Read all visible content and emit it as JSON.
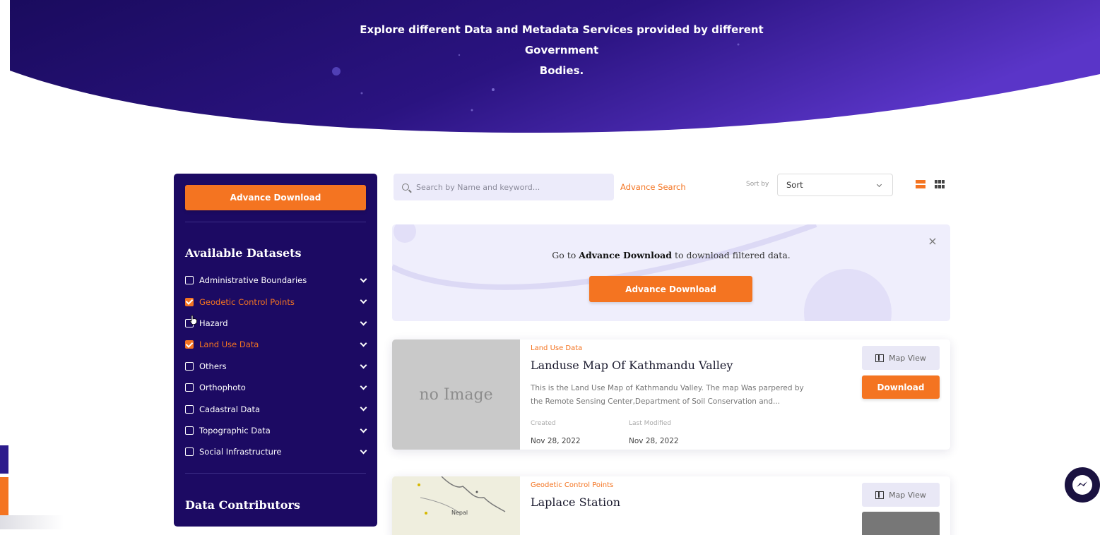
{
  "hero": {
    "line1": "Explore different Data and Metadata Services provided by different Government",
    "line2": "Bodies."
  },
  "sidebar": {
    "advance_download_label": "Advance Download",
    "datasets_heading": "Available Datasets",
    "datasets": [
      {
        "label": "Administrative Boundaries",
        "checked": false
      },
      {
        "label": "Geodetic Control Points",
        "checked": true
      },
      {
        "label": "Hazard",
        "checked": false
      },
      {
        "label": "Land Use Data",
        "checked": true
      },
      {
        "label": "Others",
        "checked": false
      },
      {
        "label": "Orthophoto",
        "checked": false
      },
      {
        "label": "Cadastral Data",
        "checked": false
      },
      {
        "label": "Topographic Data",
        "checked": false
      },
      {
        "label": "Social Infrastructure",
        "checked": false
      }
    ],
    "contributors_heading": "Data Contributors"
  },
  "toolbar": {
    "search_placeholder": "Search by Name and keyword...",
    "advance_search_label": "Advance Search",
    "sort_by_label": "Sort by",
    "sort_value": "Sort"
  },
  "banner": {
    "text_before": "Go to ",
    "text_bold": "Advance Download",
    "text_after": " to download filtered data.",
    "button_label": "Advance Download"
  },
  "results": [
    {
      "category": "Land Use Data",
      "title": "Landuse Map Of Kathmandu Valley",
      "thumbnail_text": "no Image",
      "description_line1": "This is the Land Use Map of Kathmandu Valley. The map Was parpered by",
      "description_line2": "the Remote Sensing Center,Department of Soil Conservation and...",
      "created_label": "Created",
      "created_value": "Nov 28, 2022",
      "modified_label": "Last Modified",
      "modified_value": "Nov 28, 2022",
      "map_view_label": "Map View",
      "download_label": "Download"
    },
    {
      "category": "Geodetic Control Points",
      "title": "Laplace Station",
      "thumbnail_text": "Nepal",
      "map_view_label": "Map View"
    }
  ],
  "colors": {
    "accent": "#f47421",
    "sidebar_bg": "#1c0a63",
    "hero_start": "#1a0b5e",
    "hero_end": "#5a35c8"
  }
}
